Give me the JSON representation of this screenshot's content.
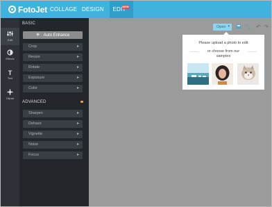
{
  "app": {
    "logo_text": "FotoJet",
    "nav": {
      "collage": "COLLAGE",
      "design": "DESIGN",
      "edit": "EDIT",
      "new_badge": "NEW"
    }
  },
  "rail": [
    {
      "label": "Edit",
      "icon": "sliders-icon",
      "active": true
    },
    {
      "label": "Effects",
      "icon": "effects-icon",
      "active": false
    },
    {
      "label": "Text",
      "icon": "text-icon",
      "active": false
    },
    {
      "label": "Clipart",
      "icon": "clipart-icon",
      "active": false
    }
  ],
  "panel": {
    "basic_title": "BASIC",
    "auto_enhance": "Auto Enhance",
    "basic_tools": [
      "Crop",
      "Resize",
      "Rotate",
      "Exposure",
      "Color"
    ],
    "advanced_title": "ADVANCED",
    "advanced_tools": [
      "Sharpen",
      "Dehaze",
      "Vignette",
      "Noise",
      "Focus"
    ]
  },
  "toolbar": {
    "open_label": "Open"
  },
  "popup": {
    "title": "Please upload a photo to edit",
    "or_line1": "or choose from our",
    "or_line2": "samples"
  },
  "colors": {
    "topbar": "#3fb3de",
    "panel": "#23272c",
    "canvas": "#9b9b9b",
    "accent": "#41a9d3"
  }
}
